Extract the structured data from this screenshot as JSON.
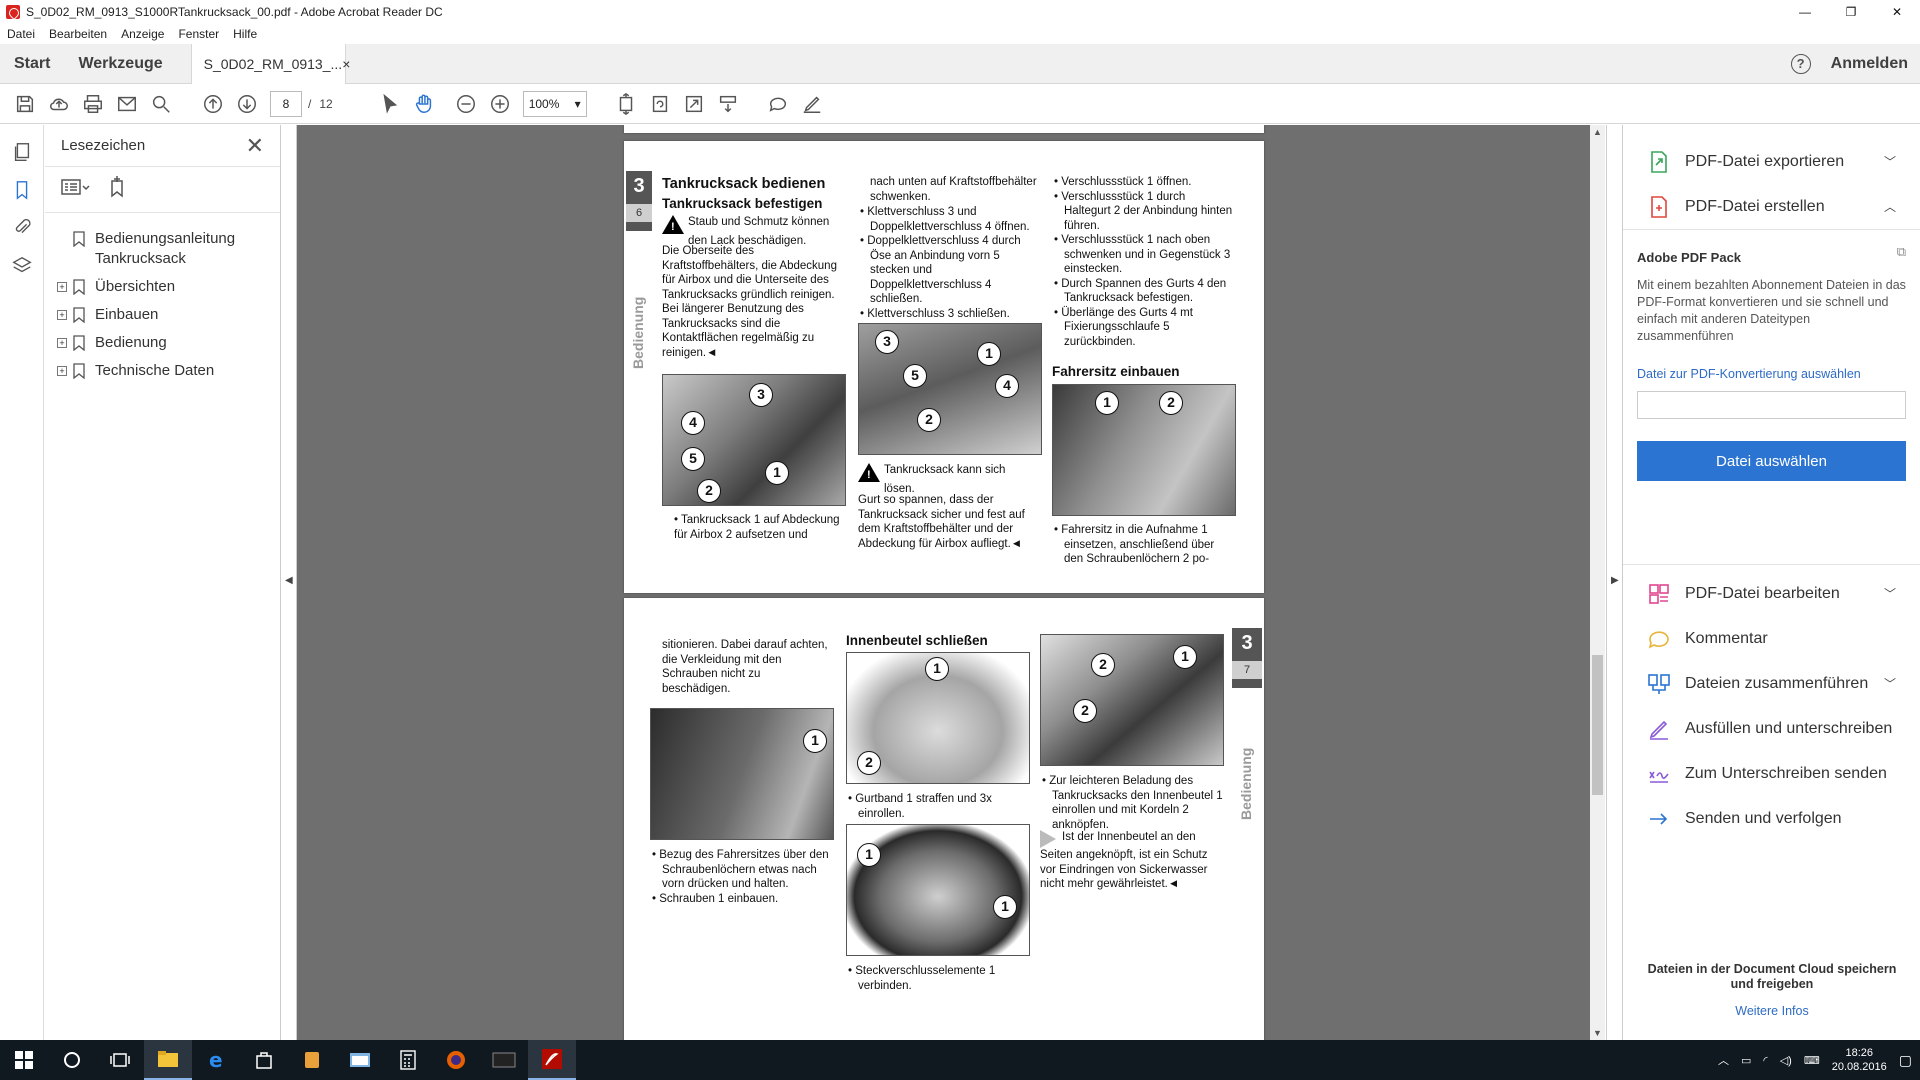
{
  "window": {
    "title": "S_0D02_RM_0913_S1000RTankrucksack_00.pdf - Adobe Acrobat Reader DC",
    "controls": [
      "—",
      "❐",
      "✕"
    ]
  },
  "menu": [
    "Datei",
    "Bearbeiten",
    "Anzeige",
    "Fenster",
    "Hilfe"
  ],
  "tabs": {
    "start": "Start",
    "tools": "Werkzeuge",
    "document": "S_0D02_RM_0913_...",
    "close": "×",
    "help": "?",
    "signin": "Anmelden"
  },
  "toolbar": {
    "page_current": "8",
    "page_sep": "/",
    "page_total": "12",
    "zoom": "100%"
  },
  "bookmarks": {
    "title": "Lesezeichen",
    "items": [
      {
        "label": "Bedienungsanleitung Tankrucksack",
        "expandable": false
      },
      {
        "label": "Übersichten",
        "expandable": true
      },
      {
        "label": "Einbauen",
        "expandable": true
      },
      {
        "label": "Bedienung",
        "expandable": true
      },
      {
        "label": "Technische Daten",
        "expandable": true
      }
    ]
  },
  "page1": {
    "chapter": "3",
    "pageno": "6",
    "side": "Bedienung",
    "h1": "Tankrucksack bedienen",
    "h2": "Tankrucksack befestigen",
    "warn1_a": "Staub und Schmutz können",
    "warn1_b": "den Lack beschädigen.",
    "col1": "Die Oberseite des Kraftstoffbehälters, die Abdeckung für Airbox und die Unterseite des Tankrucksacks gründlich reinigen.\nBei längerer Benutzung des Tankrucksacks sind die Kontaktflächen regelmäßig zu reinigen.◄",
    "col1_b": "Tankrucksack 1 auf Abdeckung für Airbox 2 aufsetzen und",
    "col2": "nach unten auf Kraftstoffbehälter schwenken.",
    "col2_list": [
      "Klettverschluss 3 und Doppelklettverschluss 4 öffnen.",
      "Doppelklettverschluss 4 durch Öse an Anbindung vorn 5 stecken und Doppelklettverschluss 4 schließen.",
      "Klettverschluss 3 schließen."
    ],
    "warn2_a": "Tankrucksack kann sich",
    "warn2_b": "lösen.",
    "col2_b": "Gurt so spannen, dass der Tankrucksack sicher und fest auf dem Kraftstoffbehälter und der Abdeckung für Airbox aufliegt.◄",
    "col3_list": [
      "Verschlussstück 1 öffnen.",
      "Verschlussstück 1 durch Haltegurt 2 der Anbindung hinten führen.",
      "Verschlussstück 1 nach oben schwenken und in Gegenstück 3 einstecken.",
      "Durch Spannen des Gurts 4 den Tankrucksack befestigen.",
      "Überlänge des Gurts 4 mt Fixierungsschlaufe 5 zurückbinden."
    ],
    "h3": "Fahrersitz einbauen",
    "col3_b": "Fahrersitz in die Aufnahme 1 einsetzen, anschließend über den Schraubenlöchern 2 po-"
  },
  "page2": {
    "chapter": "3",
    "pageno": "7",
    "side": "Bedienung",
    "col1": "sitionieren. Dabei darauf achten, die Verkleidung mit den Schrauben nicht zu beschädigen.",
    "col1_list": [
      "Bezug des Fahrersitzes über den Schraubenlöchern etwas nach vorn drücken und halten.",
      "Schrauben 1 einbauen."
    ],
    "h1": "Innenbeutel schließen",
    "col2_a": "Gurtband 1 straffen und 3x einrollen.",
    "col2_b": "Steckverschlusselemente 1 verbinden.",
    "col3_a": "Zur leichteren Beladung des Tankrucksacks den Innenbeutel 1 einrollen und mit Kordeln 2 anknöpfen.",
    "col3_note": "Ist der Innenbeutel an den Seiten angeknöpft, ist ein Schutz vor Eindringen von Sickerwasser nicht mehr gewährleistet.◄"
  },
  "rightpane": {
    "export": "PDF-Datei exportieren",
    "create": "PDF-Datei erstellen",
    "pack_title": "Adobe PDF Pack",
    "pack_desc": "Mit einem bezahlten Abonnement Dateien in das PDF-Format konvertieren und sie schnell und einfach mit anderen Dateitypen zusammenführen",
    "pack_link": "Datei zur PDF-Konvertierung auswählen",
    "pack_button": "Datei auswählen",
    "edit": "PDF-Datei bearbeiten",
    "comment": "Kommentar",
    "combine": "Dateien zusammenführen",
    "fill": "Ausfüllen und unterschreiben",
    "send_sign": "Zum Unterschreiben senden",
    "send_track": "Senden und verfolgen",
    "footer": "Dateien in der Document Cloud speichern und freigeben",
    "footer_link": "Weitere Infos"
  },
  "taskbar": {
    "time": "18:26",
    "date": "20.08.2016"
  },
  "colors": {
    "accent": "#2b74d1",
    "doc_bg": "#6f6f6f",
    "taskbar": "#101820"
  }
}
